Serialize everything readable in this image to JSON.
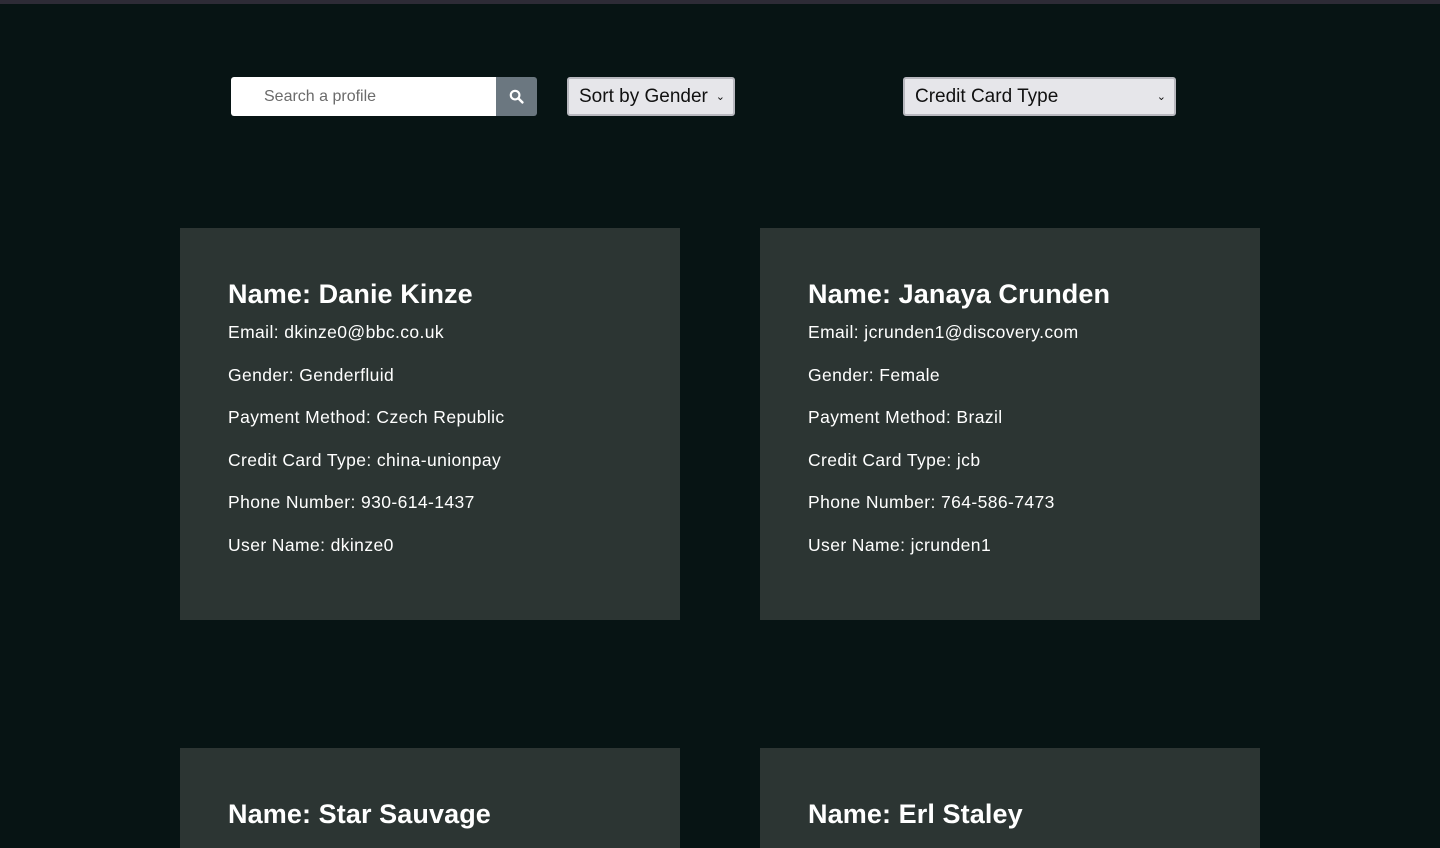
{
  "search": {
    "placeholder": "Search a profile",
    "button_icon": "search-icon"
  },
  "filters": {
    "gender_select": "Sort by Gender",
    "card_select": "Credit Card Type"
  },
  "profiles": [
    {
      "name": "Name: Danie Kinze",
      "email": "Email: dkinze0@bbc.co.uk",
      "gender": "Gender: Genderfluid",
      "payment": "Payment Method: Czech Republic",
      "card_type": "Credit Card Type: china-unionpay",
      "phone": "Phone Number: 930-614-1437",
      "username": "User Name: dkinze0"
    },
    {
      "name": "Name: Janaya Crunden",
      "email": "Email: jcrunden1@discovery.com",
      "gender": "Gender: Female",
      "payment": "Payment Method: Brazil",
      "card_type": "Credit Card Type: jcb",
      "phone": "Phone Number: 764-586-7473",
      "username": "User Name: jcrunden1"
    },
    {
      "name": "Name: Star Sauvage"
    },
    {
      "name": "Name: Erl Staley"
    }
  ],
  "colors": {
    "background": "#071414",
    "card": "#2c3533",
    "search_button": "#6b7780",
    "text": "#ffffff"
  }
}
